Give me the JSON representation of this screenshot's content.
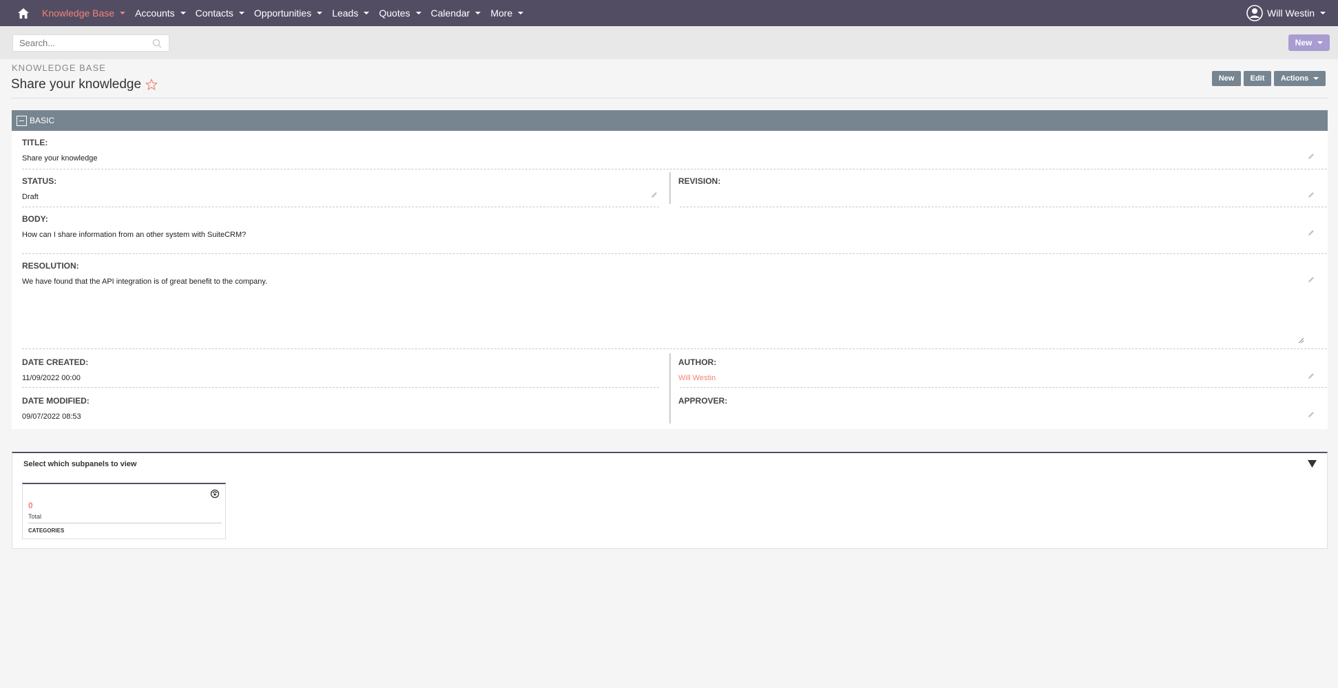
{
  "nav": {
    "items": [
      {
        "label": "Knowledge Base",
        "active": true
      },
      {
        "label": "Accounts"
      },
      {
        "label": "Contacts"
      },
      {
        "label": "Opportunities"
      },
      {
        "label": "Leads"
      },
      {
        "label": "Quotes"
      },
      {
        "label": "Calendar"
      },
      {
        "label": "More"
      }
    ],
    "user": "Will Westin"
  },
  "search": {
    "placeholder": "Search..."
  },
  "new_button": "New",
  "header": {
    "module": "KNOWLEDGE BASE",
    "title": "Share your knowledge",
    "actions": {
      "new": "New",
      "edit": "Edit",
      "actions": "Actions"
    }
  },
  "panel": {
    "name": "BASIC",
    "title_label": "TITLE:",
    "title_value": "Share your knowledge",
    "status_label": "STATUS:",
    "status_value": "Draft",
    "revision_label": "REVISION:",
    "revision_value": "",
    "body_label": "BODY:",
    "body_value": "How can I share information from an other system with SuiteCRM?",
    "resolution_label": "RESOLUTION:",
    "resolution_value": "We have found that the API integration is of great benefit to the company.",
    "date_created_label": "DATE CREATED:",
    "date_created_value": "11/09/2022 00:00",
    "author_label": "AUTHOR:",
    "author_value": "Will Westin",
    "date_modified_label": "DATE MODIFIED:",
    "date_modified_value": "09/07/2022 08:53",
    "approver_label": "APPROVER:",
    "approver_value": ""
  },
  "subpanels": {
    "title": "Select which subpanels to view",
    "cards": [
      {
        "count": "0",
        "total_label": "Total",
        "name": "CATEGORIES"
      }
    ]
  },
  "colors": {
    "nav_bg": "#534d64",
    "accent": "#f08377",
    "panel_header": "#778591",
    "new_button": "#a99cd1"
  }
}
